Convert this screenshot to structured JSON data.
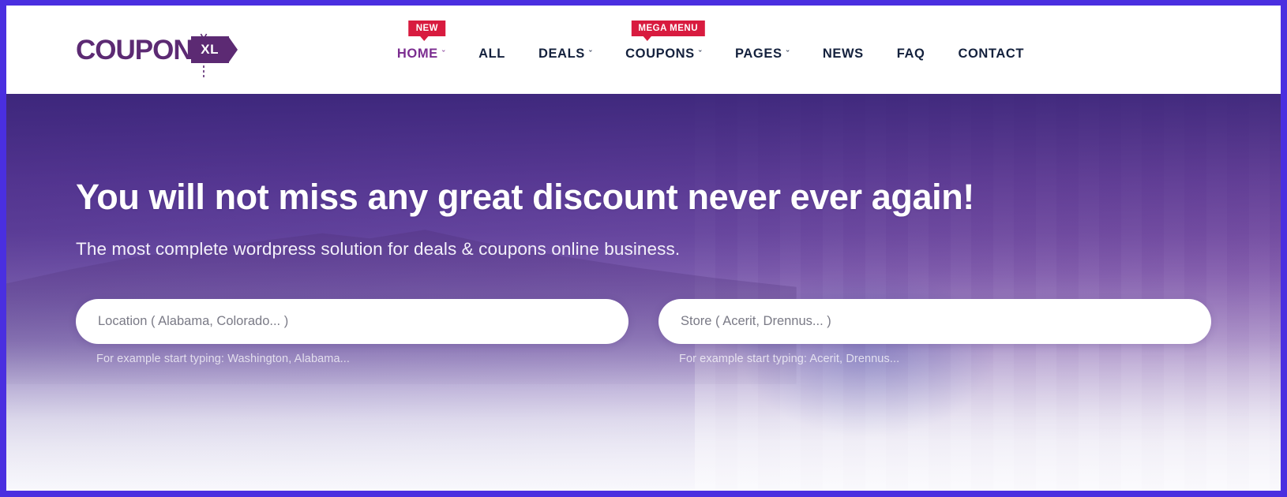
{
  "theme": {
    "page_border": "#4a2fe0",
    "brand_purple": "#5c2a73",
    "nav_active": "#7b2d90",
    "nav_text": "#14213d",
    "badge_red": "#d81b3f",
    "hero_purple": "#4a3090"
  },
  "header": {
    "logo": {
      "word": "COUPON",
      "tag": "XL",
      "scissors_icon": "scissors-icon"
    },
    "nav": [
      {
        "label": "HOME",
        "caret": "ˇ",
        "has_caret": true,
        "active": true,
        "badge": "NEW"
      },
      {
        "label": "ALL",
        "caret": "",
        "has_caret": false,
        "active": false,
        "badge": ""
      },
      {
        "label": "DEALS",
        "caret": "ˇ",
        "has_caret": true,
        "active": false,
        "badge": ""
      },
      {
        "label": "COUPONS",
        "caret": "ˇ",
        "has_caret": true,
        "active": false,
        "badge": "MEGA MENU"
      },
      {
        "label": "PAGES",
        "caret": "ˇ",
        "has_caret": true,
        "active": false,
        "badge": ""
      },
      {
        "label": "NEWS",
        "caret": "",
        "has_caret": false,
        "active": false,
        "badge": ""
      },
      {
        "label": "FAQ",
        "caret": "",
        "has_caret": false,
        "active": false,
        "badge": ""
      },
      {
        "label": "CONTACT",
        "caret": "",
        "has_caret": false,
        "active": false,
        "badge": ""
      }
    ]
  },
  "hero": {
    "title": "You will not miss any great discount never ever again!",
    "subtitle": "The most complete wordpress solution for deals & coupons online business.",
    "search": {
      "location": {
        "value": "",
        "placeholder": "Location ( Alabama, Colorado... )",
        "hint": "For example start typing: Washington, Alabama..."
      },
      "store": {
        "value": "",
        "placeholder": "Store ( Acerit, Drennus... )",
        "hint": "For example start typing: Acerit, Drennus..."
      }
    }
  }
}
